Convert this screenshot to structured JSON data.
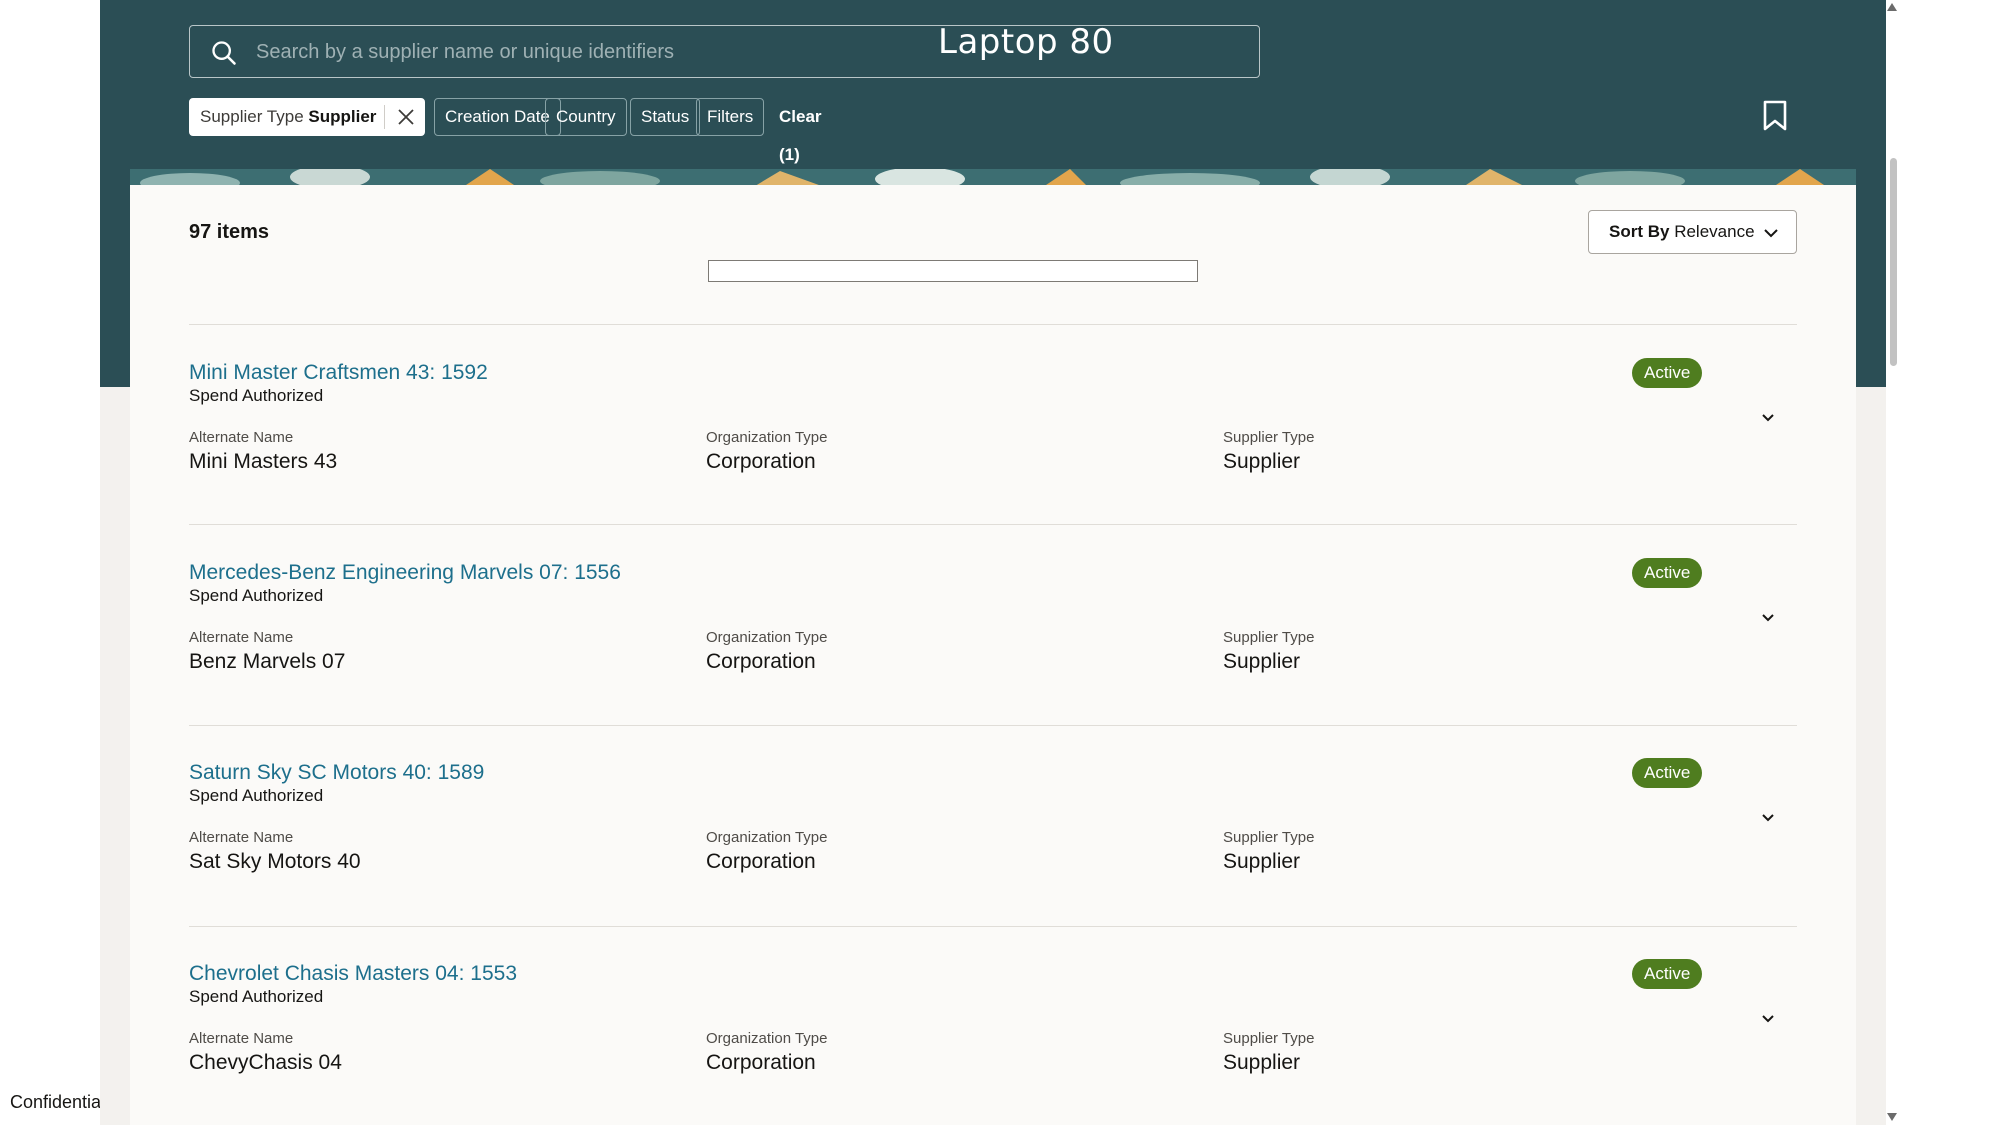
{
  "search": {
    "placeholder": "Search by a supplier name or unique identifiers"
  },
  "overlay_title": "Laptop 80",
  "filters": {
    "active_chip": {
      "label": "Supplier Type",
      "value": "Supplier"
    },
    "chips": [
      "Creation Date",
      "Country",
      "Status",
      "Filters"
    ],
    "clear_label": "Clear (1)"
  },
  "results": {
    "count_label": "97 items",
    "sort": {
      "label": "Sort By",
      "value": "Relevance"
    }
  },
  "field_labels": {
    "alternate_name": "Alternate Name",
    "organization_type": "Organization Type",
    "supplier_type": "Supplier Type"
  },
  "suppliers": [
    {
      "title": "Mini Master Craftsmen 43: 1592",
      "subtitle": "Spend Authorized",
      "alternate_name": "Mini Masters 43",
      "organization_type": "Corporation",
      "supplier_type": "Supplier",
      "status": "Active"
    },
    {
      "title": "Mercedes-Benz Engineering Marvels 07: 1556",
      "subtitle": "Spend Authorized",
      "alternate_name": "Benz Marvels 07",
      "organization_type": "Corporation",
      "supplier_type": "Supplier",
      "status": "Active"
    },
    {
      "title": "Saturn Sky SC Motors 40: 1589",
      "subtitle": "Spend Authorized",
      "alternate_name": "Sat Sky Motors 40",
      "organization_type": "Corporation",
      "supplier_type": "Supplier",
      "status": "Active"
    },
    {
      "title": "Chevrolet Chasis Masters 04: 1553",
      "subtitle": "Spend Authorized",
      "alternate_name": "ChevyChasis 04",
      "organization_type": "Corporation",
      "supplier_type": "Supplier",
      "status": "Active"
    }
  ],
  "footer_note": "Confidential",
  "colors": {
    "hero": "#2b4e55",
    "link": "#1d6f8c",
    "status_active": "#4f7d1f"
  }
}
